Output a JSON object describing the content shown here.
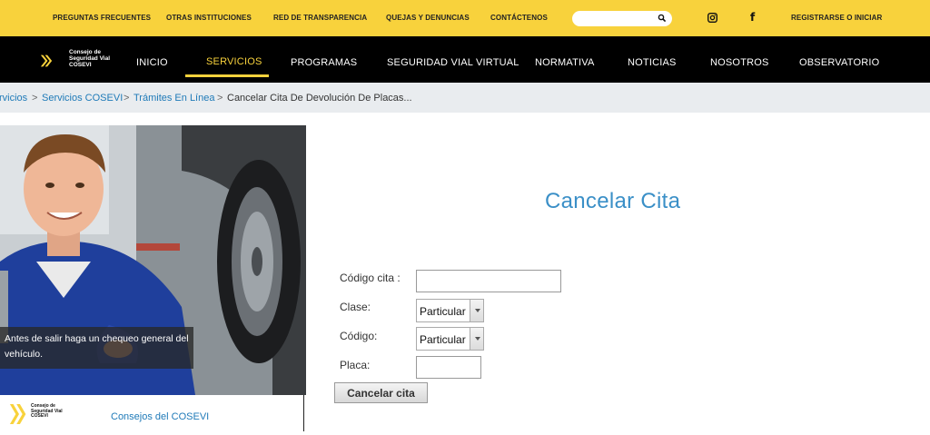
{
  "topbar": {
    "links": [
      "PREGUNTAS FRECUENTES",
      "OTRAS INSTITUCIONES",
      "RED DE TRANSPARENCIA",
      "QUEJAS Y DENUNCIAS",
      "CONTÁCTENOS"
    ],
    "search_placeholder": "",
    "login": "REGISTRARSE O INICIAR",
    "social": [
      "instagram-icon",
      "facebook-icon"
    ],
    "facebook_glyph": "f"
  },
  "nav": {
    "logo_text": [
      "Consejo de",
      "Seguridad Vial",
      "COSEVI"
    ],
    "items": [
      "INICIO",
      "SERVICIOS",
      "PROGRAMAS",
      "SEGURIDAD VIAL VIRTUAL",
      "NORMATIVA",
      "NOTICIAS",
      "NOSOTROS",
      "OBSERVATORIO"
    ],
    "active": "SERVICIOS"
  },
  "breadcrumb": {
    "items": [
      "rvicios",
      "Servicios COSEVI",
      "Trámites En Línea"
    ],
    "current": "Cancelar Cita De Devolución De Placas...",
    "separator": ">"
  },
  "banner": {
    "caption": "Antes de salir haga un chequeo general del vehículo.",
    "card_logo_text": [
      "Consejo de",
      "Seguridad Vial",
      "COSEVI"
    ],
    "card_label": "Consejos del COSEVI"
  },
  "form": {
    "title": "Cancelar Cita",
    "codigo_cita_label": "Código cita :",
    "codigo_cita_value": "",
    "clase_label": "Clase:",
    "clase_value": "Particular",
    "codigo_label": "Código:",
    "codigo_value": "Particular",
    "placa_label": "Placa:",
    "placa_value": "",
    "submit_label": "Cancelar cita"
  },
  "colors": {
    "brand_yellow": "#f8d23c",
    "nav_black": "#000000",
    "link_blue": "#1f7ab8",
    "title_blue": "#3a8fc7"
  }
}
